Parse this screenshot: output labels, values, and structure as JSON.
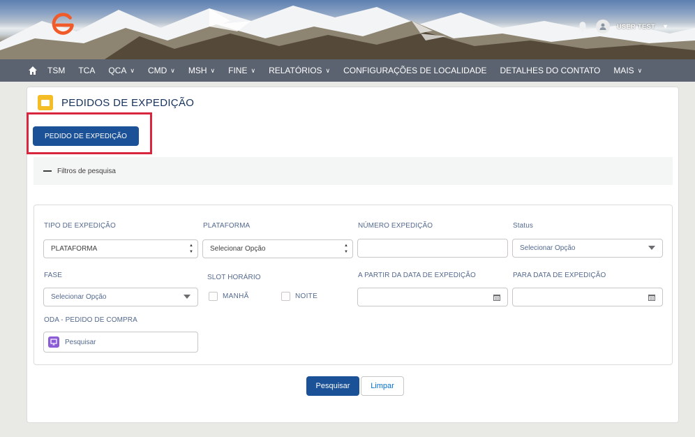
{
  "header": {
    "user_name": "USER TEST",
    "caret": "▼"
  },
  "nav": {
    "items": [
      {
        "label": "TSM",
        "has_menu": false
      },
      {
        "label": "TCA",
        "has_menu": false
      },
      {
        "label": "QCA",
        "has_menu": true
      },
      {
        "label": "CMD",
        "has_menu": true
      },
      {
        "label": "MSH",
        "has_menu": true
      },
      {
        "label": "FINE",
        "has_menu": true
      },
      {
        "label": "RELATÓRIOS",
        "has_menu": true
      },
      {
        "label": "CONFIGURAÇÕES DE LOCALIDADE",
        "has_menu": false
      },
      {
        "label": "DETALHES DO CONTATO",
        "has_menu": false
      },
      {
        "label": "MAIS",
        "has_menu": true
      }
    ],
    "chevron": "∨"
  },
  "page": {
    "title": "PEDIDOS DE EXPEDIÇÃO",
    "primary_button": "PEDIDO DE EXPEDIÇÃO",
    "filters_toggle": "Filtros de pesquisa"
  },
  "filters": {
    "tipo_label": "TIPO DE EXPEDIÇÃO",
    "tipo_value": "PLATAFORMA",
    "plataforma_label": "PLATAFORMA",
    "plataforma_value": "Selecionar Opção",
    "numero_label": "NÚMERO EXPEDIÇÃO",
    "numero_value": "",
    "status_label": "Status",
    "status_value": "Selecionar Opção",
    "fase_label": "FASE",
    "fase_value": "Selecionar Opção",
    "slot_label": "SLOT HORÁRIO",
    "slot_manha": "MANHÃ",
    "slot_noite": "NOITE",
    "data_de_label": "A PARTIR DA DATA DE EXPEDIÇÃO",
    "data_ate_label": "PARA DATA DE EXPEDIÇÃO",
    "oda_label": "ODA - PEDIDO DE COMPRA",
    "oda_placeholder": "Pesquisar"
  },
  "actions": {
    "search": "Pesquisar",
    "clear": "Limpar"
  },
  "colors": {
    "brand_blue": "#1b5297",
    "highlight_red": "#d7263d",
    "logo_orange": "#f15a29"
  }
}
